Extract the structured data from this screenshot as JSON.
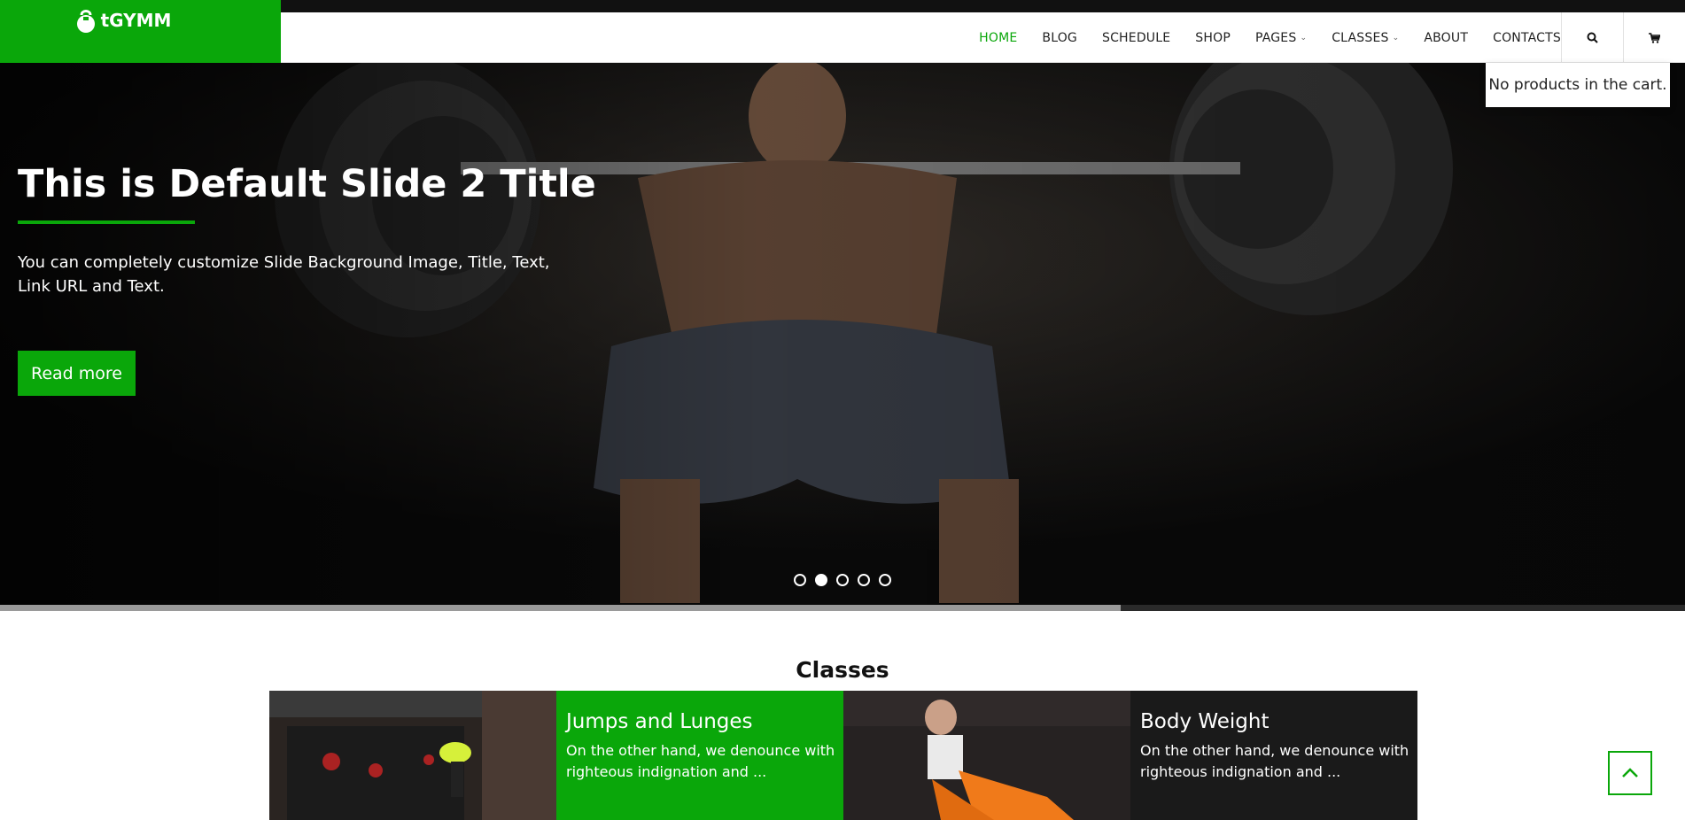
{
  "header": {
    "logo_text": "tGYMM",
    "nav": [
      {
        "label": "HOME",
        "active": true,
        "dropdown": false
      },
      {
        "label": "BLOG",
        "active": false,
        "dropdown": false
      },
      {
        "label": "SCHEDULE",
        "active": false,
        "dropdown": false
      },
      {
        "label": "SHOP",
        "active": false,
        "dropdown": false
      },
      {
        "label": "PAGES",
        "active": false,
        "dropdown": true
      },
      {
        "label": "CLASSES",
        "active": false,
        "dropdown": true
      },
      {
        "label": "ABOUT",
        "active": false,
        "dropdown": false
      },
      {
        "label": "CONTACTS",
        "active": false,
        "dropdown": false
      }
    ],
    "search_icon": "search-icon",
    "cart_icon": "cart-icon"
  },
  "cart": {
    "empty_text": "No products in the cart."
  },
  "hero": {
    "title": "This is Default Slide 2 Title",
    "text": "You can completely customize Slide Background Image, Title, Text, Link URL and Text.",
    "button_label": "Read more",
    "slide_count": 5,
    "active_slide": 2,
    "progress": 0.665
  },
  "classes": {
    "heading": "Classes",
    "items": [
      {
        "title": "Jumps and Lunges",
        "excerpt": "On the other hand, we denounce with righteous indignation and ..."
      },
      {
        "title": "Body Weight",
        "excerpt": "On the other hand, we denounce with righteous indignation and ..."
      }
    ]
  },
  "colors": {
    "accent": "#0aa70a",
    "dark": "#1a1a1a"
  }
}
